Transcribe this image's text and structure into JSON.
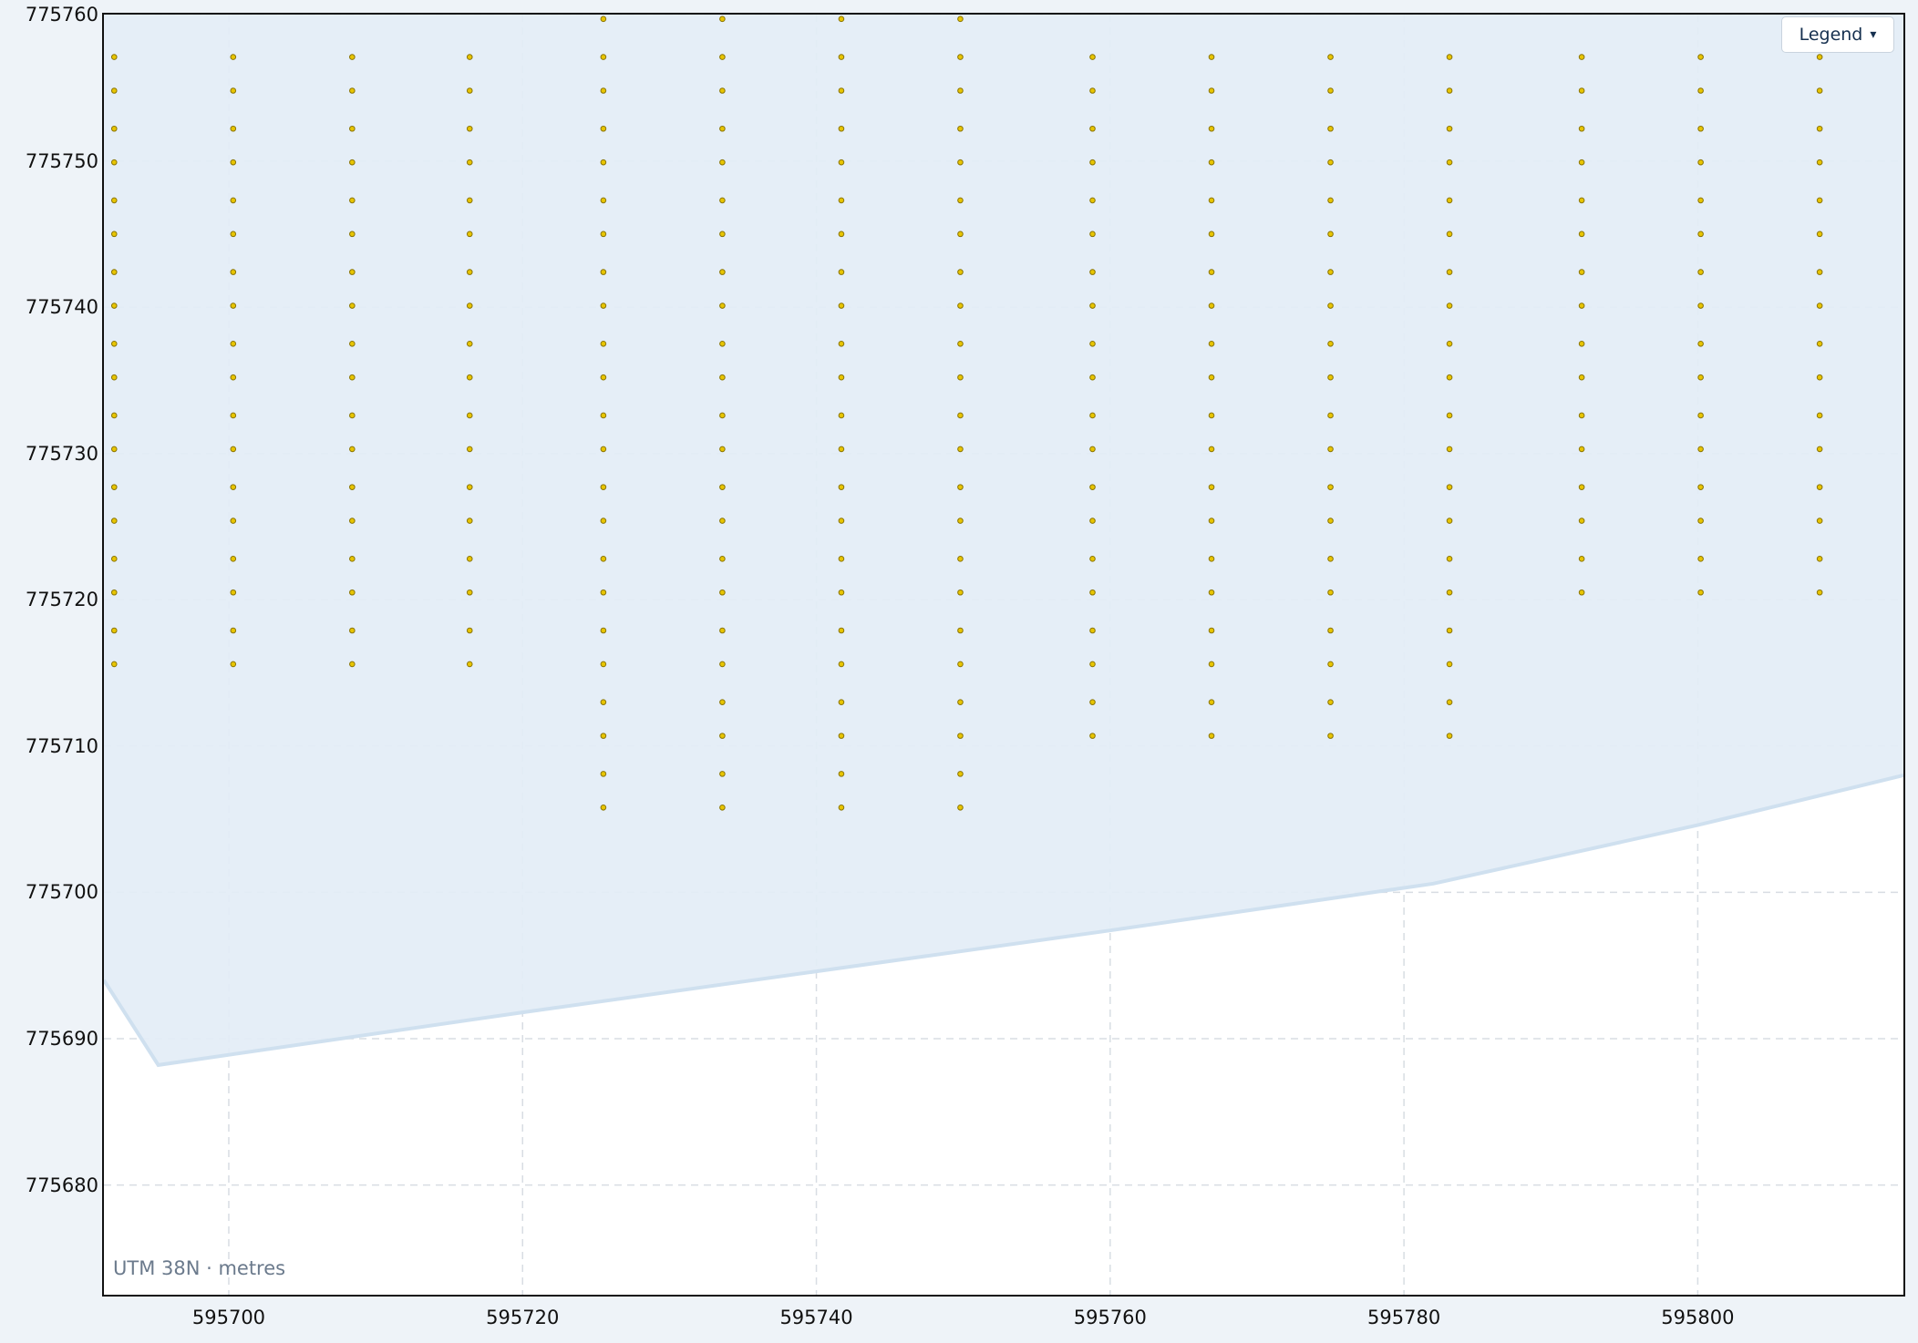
{
  "map": {
    "crs_label": "UTM 38N · metres",
    "legend_label": "Legend",
    "legend_icon": "caret-down-icon",
    "extent": {
      "x": [
        595691.5,
        595814
      ],
      "y": [
        775672.5,
        775760
      ]
    },
    "x_ticks": [
      595700,
      595720,
      595740,
      595760,
      595780,
      595800
    ],
    "y_ticks": [
      775680,
      775690,
      775700,
      775710,
      775720,
      775730,
      775740,
      775750,
      775760
    ],
    "grid": true,
    "colors": {
      "area_fill": "#e3edf6",
      "area_edge": "#cfe0ef",
      "point_fill": "#e8c500",
      "point_edge": "#8a7400",
      "grid": "#d8dde3"
    },
    "boundary": [
      [
        595691.5,
        775694
      ],
      [
        595695.2,
        775688.2
      ],
      [
        595720,
        775691.8
      ],
      [
        595740,
        775694.6
      ],
      [
        595760,
        775697.4
      ],
      [
        595782,
        775700.6
      ],
      [
        595800,
        775704.6
      ],
      [
        595814,
        775708
      ]
    ],
    "point_columns": [
      {
        "x": 595692.2,
        "rows": "a"
      },
      {
        "x": 595700.3,
        "rows": "a"
      },
      {
        "x": 595708.4,
        "rows": "a"
      },
      {
        "x": 595716.4,
        "rows": "a"
      },
      {
        "x": 595725.5,
        "rows": "b"
      },
      {
        "x": 595733.6,
        "rows": "b"
      },
      {
        "x": 595741.7,
        "rows": "b"
      },
      {
        "x": 595749.8,
        "rows": "b"
      },
      {
        "x": 595758.8,
        "rows": "c"
      },
      {
        "x": 595766.9,
        "rows": "c"
      },
      {
        "x": 595775,
        "rows": "c"
      },
      {
        "x": 595783.1,
        "rows": "c"
      },
      {
        "x": 595792.1,
        "rows": "d"
      },
      {
        "x": 595800.2,
        "rows": "d"
      },
      {
        "x": 595808.3,
        "rows": "d"
      }
    ],
    "point_rows": {
      "a": [
        775757.1,
        775754.8,
        775752.2,
        775749.9,
        775747.3,
        775745,
        775742.4,
        775740.1,
        775737.5,
        775735.2,
        775732.6,
        775730.3,
        775727.7,
        775725.4,
        775722.8,
        775720.5,
        775717.9,
        775715.6
      ],
      "b": [
        775759.7,
        775757.1,
        775754.8,
        775752.2,
        775749.9,
        775747.3,
        775745,
        775742.4,
        775740.1,
        775737.5,
        775735.2,
        775732.6,
        775730.3,
        775727.7,
        775725.4,
        775722.8,
        775720.5,
        775717.9,
        775715.6,
        775713,
        775710.7,
        775708.1,
        775705.8
      ],
      "c": [
        775757.1,
        775754.8,
        775752.2,
        775749.9,
        775747.3,
        775745,
        775742.4,
        775740.1,
        775737.5,
        775735.2,
        775732.6,
        775730.3,
        775727.7,
        775725.4,
        775722.8,
        775720.5,
        775717.9,
        775715.6,
        775713,
        775710.7
      ],
      "d": [
        775757.1,
        775754.8,
        775752.2,
        775749.9,
        775747.3,
        775745,
        775742.4,
        775740.1,
        775737.5,
        775735.2,
        775732.6,
        775730.3,
        775727.7,
        775725.4,
        775722.8,
        775720.5
      ]
    }
  }
}
